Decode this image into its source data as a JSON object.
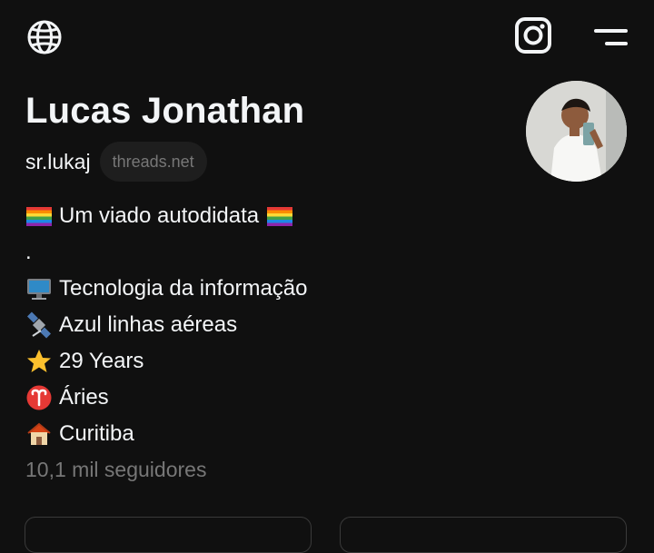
{
  "header": {
    "icons": [
      "globe-icon",
      "instagram-icon",
      "menu-icon"
    ]
  },
  "profile": {
    "name": "Lucas Jonathan",
    "username": "sr.lukaj",
    "domain_chip": "threads.net",
    "followers": "10,1 mil seguidores"
  },
  "bio": {
    "line1": "Um viado autodidata",
    "line2": ".",
    "line3": "Tecnologia da informação",
    "line4": "Azul linhas aéreas",
    "line5": "29 Years",
    "line6": "Áries",
    "line7": "Curitiba"
  },
  "colors": {
    "background": "#101010",
    "text": "#f3f5f7",
    "muted": "#777777",
    "chip": "#1e1e1e"
  }
}
